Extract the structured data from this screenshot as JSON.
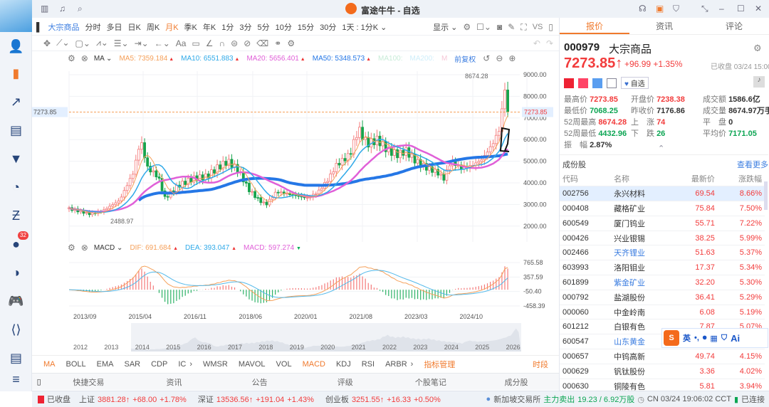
{
  "window": {
    "title": "富途牛牛 - 自选"
  },
  "sidebar": {
    "badge": "32"
  },
  "toolbar": {
    "symbol": "大宗商品",
    "periods": [
      "分时",
      "多日",
      "日K",
      "周K",
      "月K",
      "季K",
      "年K",
      "1分",
      "3分",
      "5分",
      "10分",
      "15分",
      "30分"
    ],
    "active_period": "月K",
    "interval_select": "1天 : 1分K",
    "display": "显示",
    "vs": "VS"
  },
  "ma_legend": {
    "title": "MA",
    "items": [
      {
        "label": "MA5:",
        "value": "7359.184",
        "color": "#f5a05a"
      },
      {
        "label": "MA10:",
        "value": "6551.883",
        "color": "#2fa9e8"
      },
      {
        "label": "MA20:",
        "value": "5656.401",
        "color": "#e060d8"
      },
      {
        "label": "MA50:",
        "value": "5348.573",
        "color": "#2577e6"
      },
      {
        "label": "MA100:",
        "value": "",
        "color": "#c8ecd8"
      },
      {
        "label": "MA200:",
        "value": "",
        "color": "#cfeefa"
      },
      {
        "label": "M",
        "value": "",
        "color": "#f6c8d8"
      }
    ],
    "adjust": "前复权"
  },
  "macd_legend": {
    "title": "MACD",
    "dif_label": "DIF:",
    "dif": "691.684",
    "dea_label": "DEA:",
    "dea": "393.047",
    "macd_label": "MACD:",
    "macd": "597.274"
  },
  "chart_data": {
    "type": "candlestick",
    "price_axis": [
      "9000.00",
      "8000.00",
      "7000.00",
      "6000.00",
      "5000.00",
      "4000.00",
      "3000.00",
      "2000.00"
    ],
    "ylim": [
      2000,
      9000
    ],
    "current_price_label": "7273.85",
    "high_label": "8674.28",
    "low_label": "2488.97",
    "macd_axis": [
      "765.58",
      "357.59",
      "-50.40",
      "-458.39"
    ],
    "time_axis": [
      "2013/09",
      "2015/04",
      "2016/11",
      "2018/06",
      "2020/01",
      "2021/08",
      "2023/03",
      "2024/10"
    ],
    "navigator_years": [
      "2012",
      "2013",
      "2014",
      "2015",
      "2016",
      "2017",
      "2018",
      "2019",
      "2020",
      "2021",
      "2022",
      "2023",
      "2024",
      "2025",
      "2026"
    ],
    "close_keypoints": [
      [
        2013.4,
        2800
      ],
      [
        2013.95,
        2560
      ],
      [
        2014.3,
        2700
      ],
      [
        2014.8,
        3200
      ],
      [
        2015.2,
        4500
      ],
      [
        2015.4,
        6000
      ],
      [
        2015.6,
        4700
      ],
      [
        2015.9,
        4300
      ],
      [
        2016.1,
        3300
      ],
      [
        2016.5,
        3900
      ],
      [
        2016.9,
        4200
      ],
      [
        2017.3,
        4300
      ],
      [
        2017.6,
        4700
      ],
      [
        2017.9,
        5000
      ],
      [
        2018.2,
        4600
      ],
      [
        2018.5,
        3700
      ],
      [
        2018.8,
        3200
      ],
      [
        2019.0,
        3000
      ],
      [
        2019.3,
        3600
      ],
      [
        2019.6,
        3500
      ],
      [
        2019.9,
        3400
      ],
      [
        2020.2,
        3300
      ],
      [
        2020.5,
        3600
      ],
      [
        2020.8,
        4200
      ],
      [
        2021.0,
        4800
      ],
      [
        2021.4,
        5300
      ],
      [
        2021.65,
        6500
      ],
      [
        2021.9,
        5800
      ],
      [
        2022.2,
        6000
      ],
      [
        2022.5,
        5500
      ],
      [
        2022.8,
        5300
      ],
      [
        2023.0,
        5500
      ],
      [
        2023.3,
        5000
      ],
      [
        2023.6,
        4700
      ],
      [
        2023.9,
        4500
      ],
      [
        2024.1,
        4200
      ],
      [
        2024.3,
        5000
      ],
      [
        2024.6,
        4700
      ],
      [
        2024.9,
        4800
      ],
      [
        2025.2,
        5100
      ],
      [
        2025.5,
        5800
      ],
      [
        2025.7,
        6500
      ],
      [
        2025.85,
        8400
      ],
      [
        2025.95,
        7274
      ]
    ]
  },
  "indicators": {
    "items": [
      "MA",
      "BOLL",
      "EMA",
      "SAR",
      "CDP",
      "IC",
      "WMSR",
      "MAVOL",
      "VOL",
      "MACD",
      "KDJ",
      "RSI",
      "ARBR"
    ],
    "manage": "指标管理",
    "period": "时段"
  },
  "bottom_tabs": [
    "快捷交易",
    "资讯",
    "公告",
    "评级",
    "个股笔记",
    "成分股"
  ],
  "quote": {
    "tabs": [
      "报价",
      "资讯",
      "评论"
    ],
    "code": "000979",
    "name": "大宗商品",
    "price": "7273.85",
    "change": "+96.99",
    "change_pct": "+1.35%",
    "status": "已收盘 03/24 15:00",
    "watch": "自选",
    "stats": [
      [
        "最高价",
        "7273.85",
        "red"
      ],
      [
        "开盘价",
        "7238.38",
        "red"
      ],
      [
        "成交额",
        "1586.6亿",
        "dark"
      ],
      [
        "最低价",
        "7068.25",
        "grn"
      ],
      [
        "昨收价",
        "7176.86",
        "dark"
      ],
      [
        "成交量",
        "8674.97万手",
        "dark"
      ],
      [
        "52周最高",
        "8674.28",
        "red"
      ],
      [
        "上　涨",
        "74",
        "red"
      ],
      [
        "平　盘",
        "0",
        "dark"
      ],
      [
        "52周最低",
        "4432.96",
        "grn"
      ],
      [
        "下　跌",
        "26",
        "grn"
      ],
      [
        "平均价",
        "7171.05",
        "grn"
      ],
      [
        "振　幅",
        "2.87%",
        "dark"
      ]
    ]
  },
  "constituents": {
    "title": "成份股",
    "more": "查看更多",
    "headers": [
      "代码",
      "名称",
      "最新价",
      "涨跌幅"
    ],
    "rows": [
      [
        "002756",
        "永兴材料",
        "69.54",
        "8.66%"
      ],
      [
        "000408",
        "藏格矿业",
        "75.84",
        "7.50%"
      ],
      [
        "600549",
        "厦门钨业",
        "55.71",
        "7.22%"
      ],
      [
        "000426",
        "兴业银锡",
        "38.25",
        "5.99%"
      ],
      [
        "002466",
        "天齐锂业",
        "51.63",
        "5.37%"
      ],
      [
        "603993",
        "洛阳钼业",
        "17.37",
        "5.34%"
      ],
      [
        "601899",
        "紫金矿业",
        "32.20",
        "5.30%"
      ],
      [
        "000792",
        "盐湖股份",
        "36.41",
        "5.29%"
      ],
      [
        "000060",
        "中金岭南",
        "6.08",
        "5.19%"
      ],
      [
        "601212",
        "白银有色",
        "7.87",
        "5.07%"
      ],
      [
        "600547",
        "山东黄金",
        "",
        "5.07%"
      ],
      [
        "000657",
        "中钨高新",
        "49.74",
        "4.15%"
      ],
      [
        "000629",
        "钒钛股份",
        "3.36",
        "4.02%"
      ],
      [
        "000630",
        "铜陵有色",
        "5.81",
        "3.94%"
      ]
    ],
    "link_names": [
      "002466",
      "601899",
      "600547"
    ]
  },
  "ime": {
    "label": "英",
    "ai": "Ai"
  },
  "statusbar": {
    "market": "已收盘",
    "idx": [
      {
        "n": "上证",
        "v": "3881.28↑",
        "c": "+68.00",
        "p": "+1.78%"
      },
      {
        "n": "深证",
        "v": "13536.56↑",
        "c": "+191.04",
        "p": "+1.43%"
      },
      {
        "n": "创业板",
        "v": "3251.55↑",
        "c": "+16.33",
        "p": "+0.50%"
      }
    ],
    "exchange": "新加坡交易所",
    "flow_label": "主力卖出",
    "flow": "19.23 / 6.92万股",
    "time": "CN 03/24 19:06:02 CCT",
    "conn": "已连接"
  }
}
